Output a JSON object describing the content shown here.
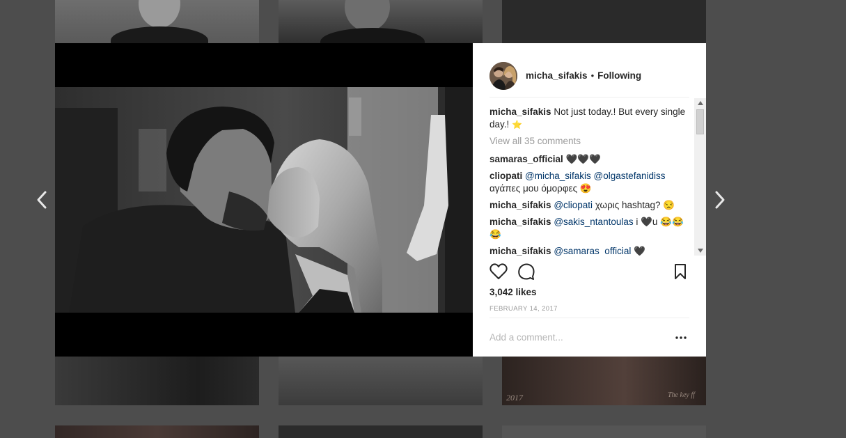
{
  "post": {
    "username": "micha_sifakis",
    "separator": "•",
    "follow_status": "Following",
    "caption_user": "micha_sifakis",
    "caption_text": "Not just today.! But every single day.!",
    "caption_emoji": "⭐",
    "view_all": "View all 35 comments",
    "comments": [
      {
        "user": "samaras_official",
        "segments": [
          {
            "text": " 🖤🖤🖤",
            "type": "text"
          }
        ]
      },
      {
        "user": "cliopati",
        "segments": [
          {
            "text": " ",
            "type": "text"
          },
          {
            "text": "@micha_sifakis",
            "type": "mention"
          },
          {
            "text": " ",
            "type": "text"
          },
          {
            "text": "@olgastefanidiss",
            "type": "mention"
          },
          {
            "text": " αγάπες μου όμορφες 😍",
            "type": "text"
          }
        ]
      },
      {
        "user": "micha_sifakis",
        "segments": [
          {
            "text": " ",
            "type": "text"
          },
          {
            "text": "@cliopati",
            "type": "mention"
          },
          {
            "text": " χωρις hashtag? 😒",
            "type": "text"
          }
        ]
      },
      {
        "user": "micha_sifakis",
        "segments": [
          {
            "text": " ",
            "type": "text"
          },
          {
            "text": "@sakis_ntantoulas",
            "type": "mention"
          },
          {
            "text": " i 🖤u 😂😂😂",
            "type": "text"
          }
        ]
      },
      {
        "user": "micha_sifakis",
        "segments": [
          {
            "text": " ",
            "type": "text"
          },
          {
            "text": "@samaras_official",
            "type": "mention"
          },
          {
            "text": " 🖤",
            "type": "text"
          }
        ]
      }
    ],
    "likes": "3,042 likes",
    "date": "FEBRUARY 14, 2017",
    "add_comment_placeholder": "Add a comment..."
  },
  "background": {
    "watermark_left": "2017",
    "watermark_right": "The key ff"
  },
  "icons": {
    "prev": "chevron-left-icon",
    "next": "chevron-right-icon",
    "like": "heart-icon",
    "comment": "comment-bubble-icon",
    "save": "bookmark-icon",
    "more": "more-dots-icon"
  }
}
